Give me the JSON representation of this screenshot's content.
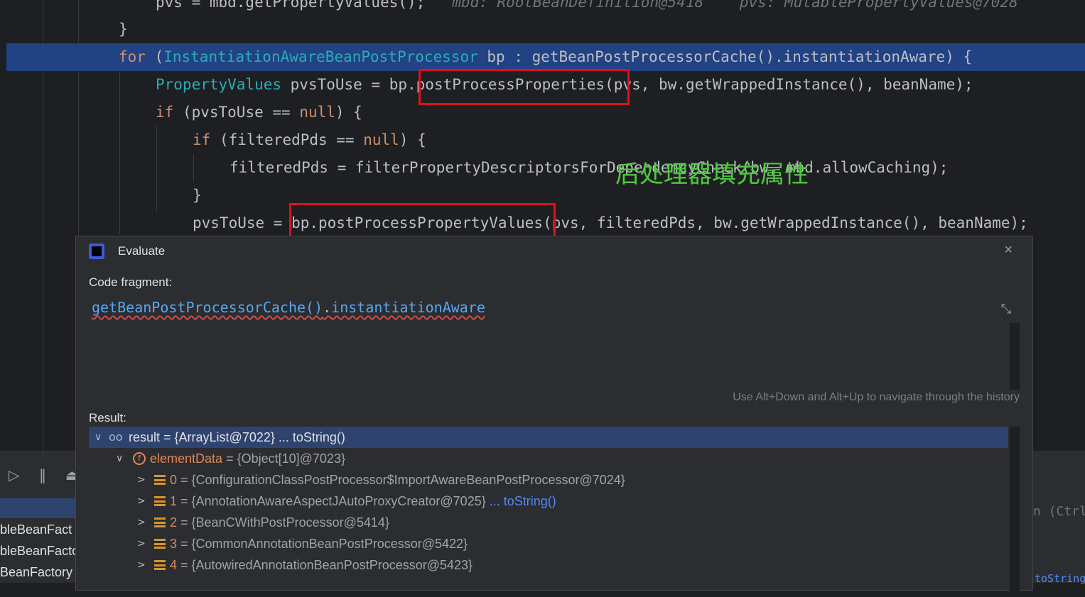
{
  "editor": {
    "lines": [
      {
        "prefix": "pvs = mbd.getPropertyValues();",
        "hint": "   mbd: RootBeanDefinition@5418    pvs: MutablePropertyValues@7028"
      },
      {
        "text": "}"
      },
      {
        "kw": "for",
        "p1": " (",
        "type": "InstantiationAwareBeanPostProcessor",
        "p2": " bp : getBeanPostProcessorCache().instantiationAware) {"
      },
      {
        "type": "PropertyValues",
        "rest": " pvsToUse = bp.postProcessProperties(pvs, bw.getWrappedInstance(), beanName);"
      },
      {
        "kw": "if",
        "rest": " (pvsToUse == ",
        "kw2": "null",
        "rest2": ") {"
      },
      {
        "kw": "if",
        "rest": " (filteredPds == ",
        "kw2": "null",
        "rest2": ") {"
      },
      {
        "text": "filteredPds = filterPropertyDescriptorsForDependencyCheck(bw, mbd.allowCaching);"
      },
      {
        "text": "}"
      },
      {
        "text": "pvsToUse = bp.postProcessPropertyValues(pvs, filteredPds, bw.getWrappedInstance(), beanName);"
      }
    ],
    "annotation": "后处理器填充属性"
  },
  "debugger": {
    "frames": [
      "bleBeanFact",
      "bleBeanFacto",
      "BeanFactory"
    ],
    "right_hint": "n (Ctrl",
    "right_hint2": "toString()"
  },
  "dialog": {
    "title": "Evaluate",
    "close": "×",
    "code_fragment_label": "Code fragment:",
    "fragment_a": "getBeanPostProcessorCache()",
    "fragment_dot": ".",
    "fragment_b": "instantiationAware",
    "history_hint": "Use Alt+Down and Alt+Up to navigate through the history",
    "result_label": "Result:",
    "tree": [
      {
        "name": "result",
        "value": " = {ArrayList@7022}",
        "link": " ... toString()"
      },
      {
        "name": "elementData",
        "value": " = {Object[10]@7023}"
      },
      {
        "index": "0",
        "value": " = {ConfigurationClassPostProcessor$ImportAwareBeanPostProcessor@7024}"
      },
      {
        "index": "1",
        "value": " = {AnnotationAwareAspectJAutoProxyCreator@7025}",
        "link": "  ... toString()"
      },
      {
        "index": "2",
        "value": " = {BeanCWithPostProcessor@5414}"
      },
      {
        "index": "3",
        "value": " = {CommonAnnotationBeanPostProcessor@5422}"
      },
      {
        "index": "4",
        "value": " = {AutowiredAnnotationBeanPostProcessor@5423}"
      }
    ]
  },
  "colors": {
    "keyword": "#cf8e6d",
    "type": "#2aacb8",
    "selection": "#214283",
    "annotation": "#4ec93e",
    "highlight_box": "#e0101f"
  }
}
